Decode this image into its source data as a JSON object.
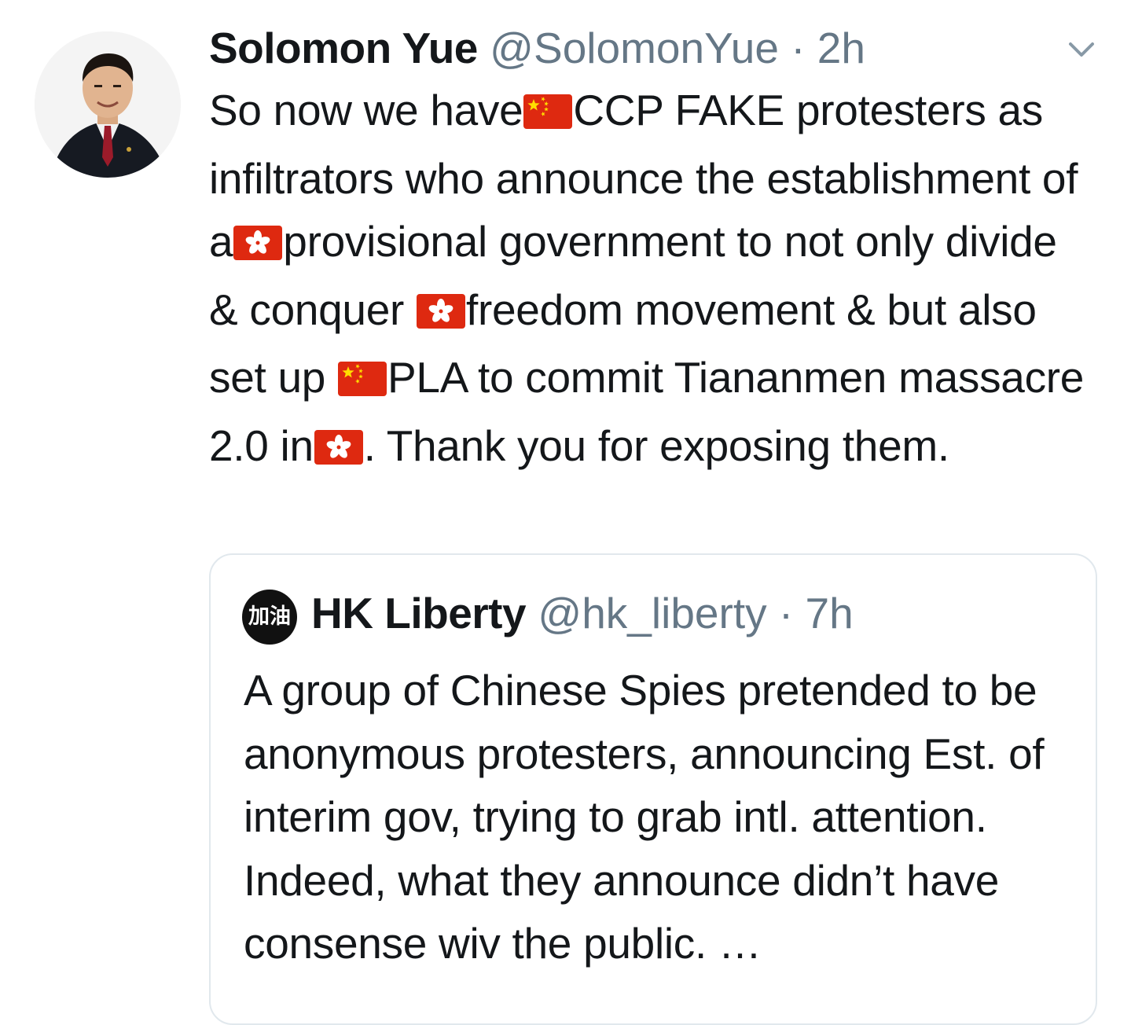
{
  "tweet": {
    "author_name": "Solomon Yue",
    "author_handle": "@SolomonYue",
    "separator": "·",
    "time": "2h",
    "segments": [
      {
        "type": "text",
        "value": "So now we have"
      },
      {
        "type": "flag",
        "value": "china-flag"
      },
      {
        "type": "text",
        "value": "CCP FAKE protesters as infiltrators who announce the establishment of a"
      },
      {
        "type": "flag",
        "value": "hong-kong-flag"
      },
      {
        "type": "text",
        "value": "provisional government to not only divide & conquer "
      },
      {
        "type": "flag",
        "value": "hong-kong-flag"
      },
      {
        "type": "text",
        "value": "freedom movement & but also set up "
      },
      {
        "type": "flag",
        "value": "china-flag"
      },
      {
        "type": "text",
        "value": "PLA to commit Tiananmen massacre 2.0 in"
      },
      {
        "type": "flag",
        "value": "hong-kong-flag"
      },
      {
        "type": "text",
        "value": ". Thank you for exposing them."
      }
    ]
  },
  "quoted_tweet": {
    "avatar_text": "加油",
    "author_name": "HK Liberty",
    "author_handle": "@hk_liberty",
    "separator": "·",
    "time": "7h",
    "text": "A group of Chinese Spies pretended to be anonymous protesters, announcing Est. of interim gov, trying to grab intl. attention. Indeed, what they announce didn’t have consense wiv the public. …"
  },
  "icons": {
    "menu": "chevron-down-icon",
    "china_flag_color": "#de2910",
    "china_star_color": "#ffde00",
    "hk_flag_color": "#de2910"
  }
}
